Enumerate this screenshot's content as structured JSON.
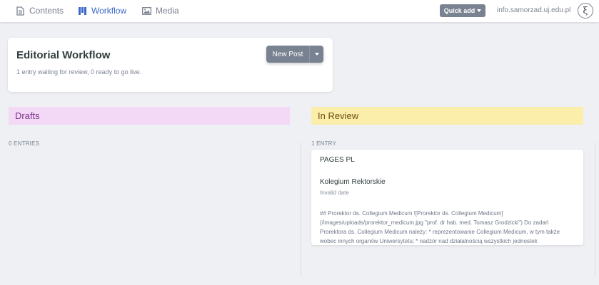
{
  "nav": {
    "tabs": [
      {
        "label": "Contents",
        "icon": "page-icon"
      },
      {
        "label": "Workflow",
        "icon": "workflow-columns-icon",
        "active": true
      },
      {
        "label": "Media",
        "icon": "image-icon"
      }
    ],
    "quick_add_label": "Quick add",
    "site_link": "info.samorzad.uj.edu.pl"
  },
  "workflow": {
    "title": "Editorial Workflow",
    "summary": "1 entry waiting for review, 0 ready to go live.",
    "new_post_label": "New Post"
  },
  "columns": [
    {
      "title": "Drafts",
      "count_label": "0 ENTRIES",
      "color": "#f4d9f7"
    },
    {
      "title": "In Review",
      "count_label": "1 ENTRY",
      "color": "#fbeeab"
    }
  ],
  "review_entry": {
    "collection": "PAGES PL",
    "title": "Kolegium Rektorskie",
    "date": "Invalid date",
    "body": "## Prorektor ds. Collegium Medicum ![Prorektor ds. Collegium Medicum](/images/uploads/prorektor_medicum.jpg \"prof. dr hab. med. Tomasz Grodzicki\") Do zadań Prorektora ds. Collegium Medicum należy: * reprezentowanie Collegium Medicum, w tym także wobec innych organów Uniwersytetu; * nadzór nad działalnością wszystkich jednostek"
  },
  "colors": {
    "accent": "#3a69c7",
    "button": "#798291",
    "background": "#eff0f4"
  }
}
